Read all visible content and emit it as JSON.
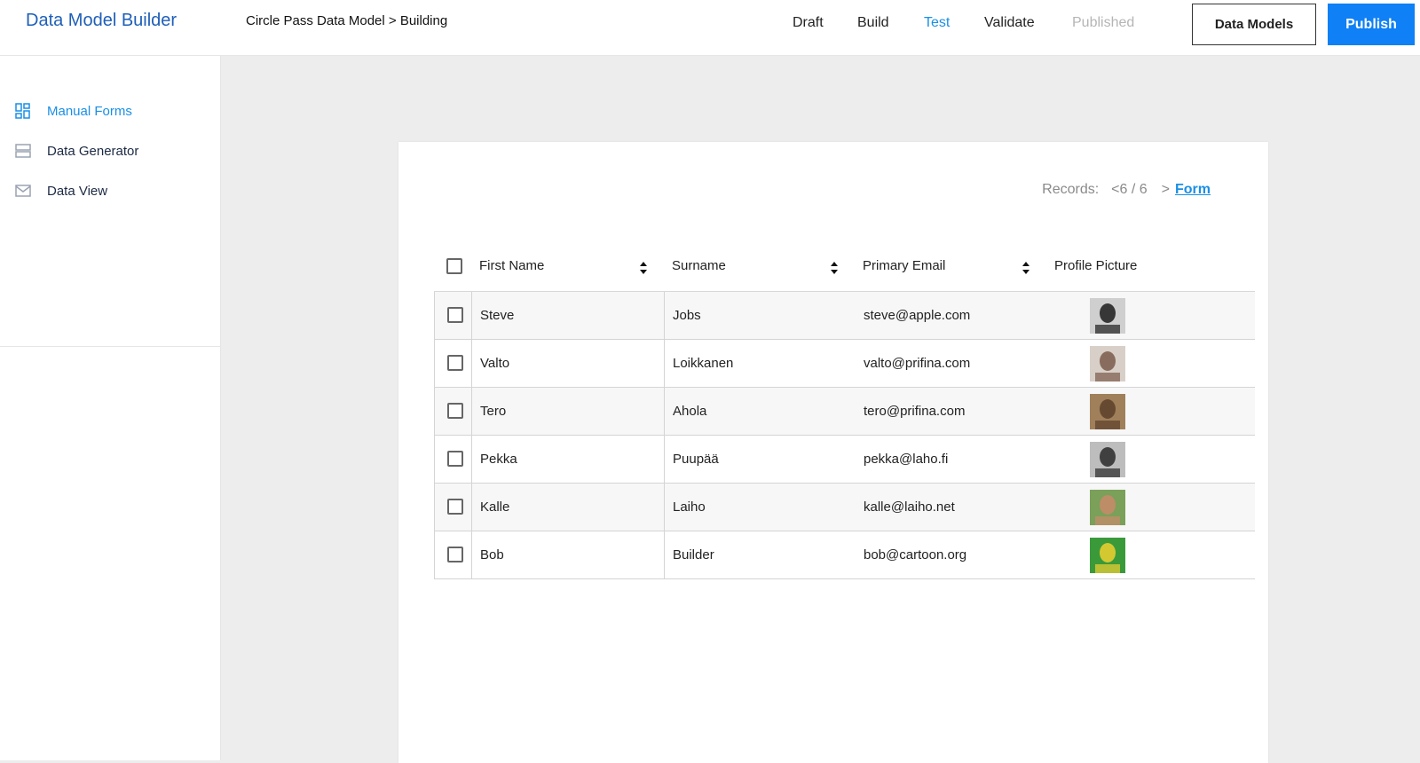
{
  "header": {
    "app_title": "Data Model Builder",
    "breadcrumb": "Circle Pass Data Model > Building",
    "nav": [
      {
        "label": "Draft",
        "state": "default"
      },
      {
        "label": "Build",
        "state": "default"
      },
      {
        "label": "Test",
        "state": "active"
      },
      {
        "label": "Validate",
        "state": "default"
      },
      {
        "label": "Published",
        "state": "disabled"
      }
    ],
    "data_models_button": "Data Models",
    "publish_button": "Publish"
  },
  "sidebar": {
    "items": [
      {
        "label": "Manual Forms",
        "icon": "dashboard-grid-icon",
        "active": true
      },
      {
        "label": "Data Generator",
        "icon": "stacked-rows-icon",
        "active": false
      },
      {
        "label": "Data View",
        "icon": "envelope-icon",
        "active": false
      }
    ]
  },
  "records": {
    "label": "Records:",
    "prev": "<",
    "count": "6 / 6",
    "next": ">",
    "form_link": "Form"
  },
  "table": {
    "columns": [
      "First Name",
      "Surname",
      "Primary Email",
      "Profile Picture"
    ],
    "rows": [
      {
        "first": "Steve",
        "surname": "Jobs",
        "email": "steve@apple.com",
        "avatar_colors": [
          "#1c1c1c",
          "#cfcfcf"
        ]
      },
      {
        "first": "Valto",
        "surname": "Loikkanen",
        "email": "valto@prifina.com",
        "avatar_colors": [
          "#7a5a4a",
          "#d8d0c8"
        ]
      },
      {
        "first": "Tero",
        "surname": "Ahola",
        "email": "tero@prifina.com",
        "avatar_colors": [
          "#5b3f2a",
          "#a0805a"
        ]
      },
      {
        "first": "Pekka",
        "surname": "Puupää",
        "email": "pekka@laho.fi",
        "avatar_colors": [
          "#2a2a2a",
          "#bdbdbd"
        ]
      },
      {
        "first": "Kalle",
        "surname": "Laiho",
        "email": "kalle@laiho.net",
        "avatar_colors": [
          "#c98a6a",
          "#7aa05a"
        ]
      },
      {
        "first": "Bob",
        "surname": "Builder",
        "email": "bob@cartoon.org",
        "avatar_colors": [
          "#f0d030",
          "#3a9a3a"
        ]
      }
    ]
  },
  "colors": {
    "accent": "#1a8fe6",
    "brand": "#1f5fb8",
    "primary_button": "#0f80f5"
  }
}
